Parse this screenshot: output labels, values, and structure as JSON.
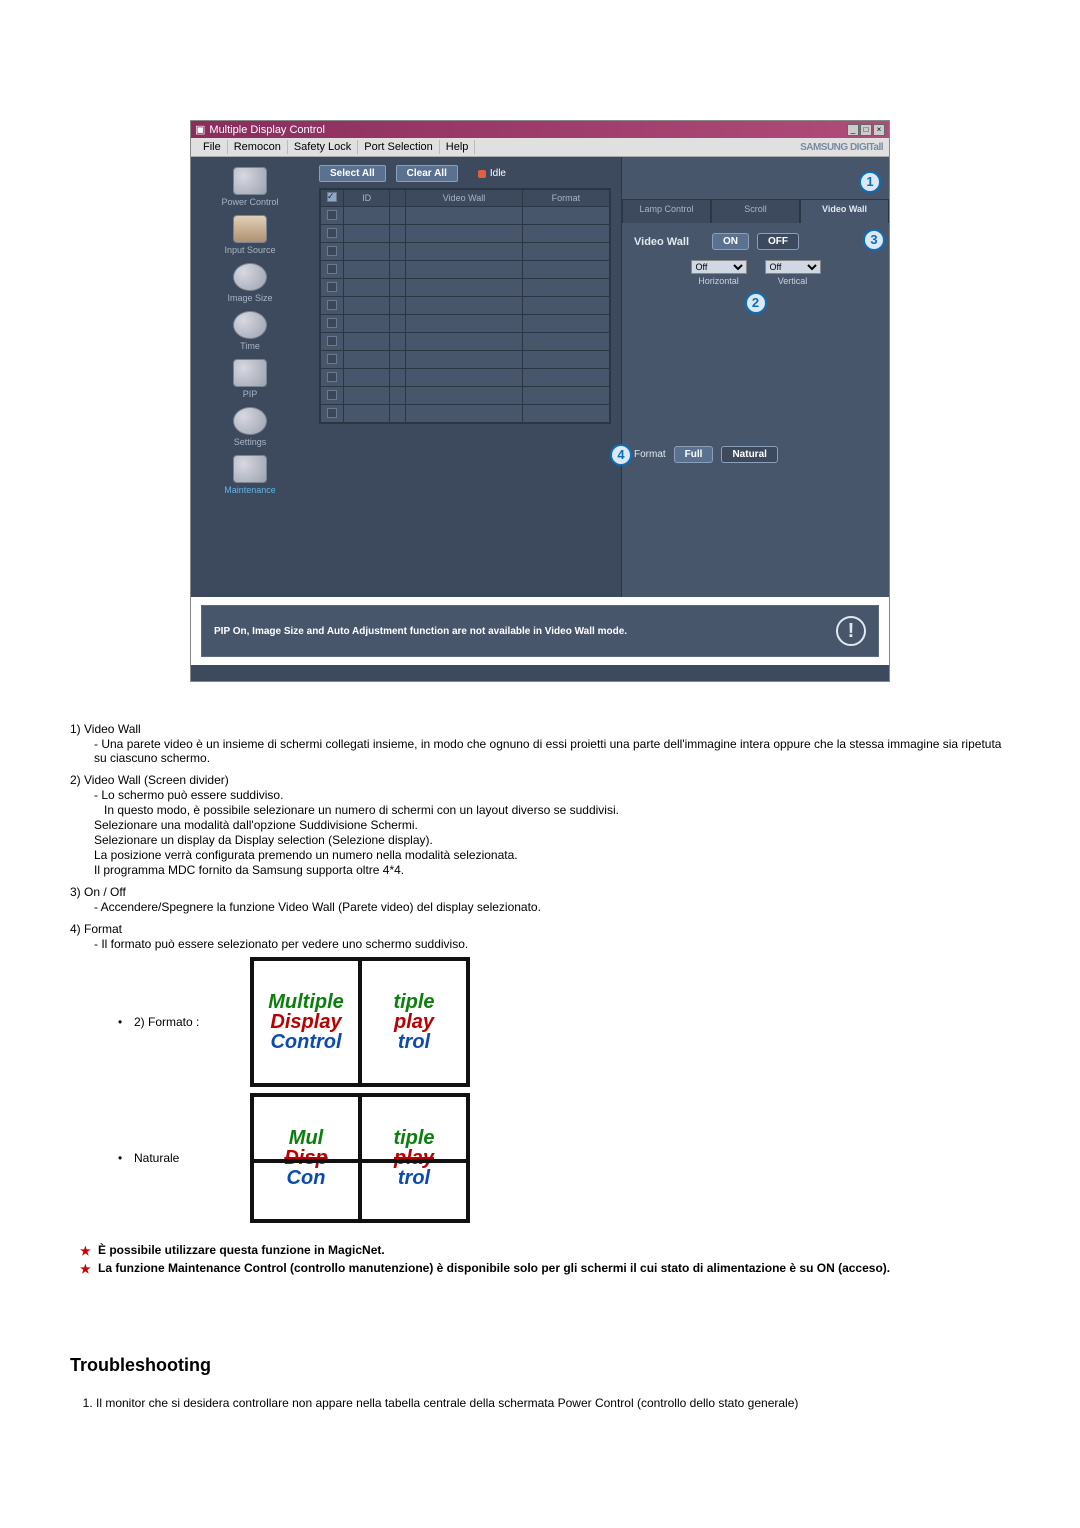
{
  "window": {
    "title": "Multiple Display Control",
    "menus": [
      "File",
      "Remocon",
      "Safety Lock",
      "Port Selection",
      "Help"
    ],
    "brand": "SAMSUNG DIGITall"
  },
  "sidebar": {
    "items": [
      {
        "label": "Power Control"
      },
      {
        "label": "Input Source"
      },
      {
        "label": "Image Size"
      },
      {
        "label": "Time"
      },
      {
        "label": "PIP"
      },
      {
        "label": "Settings"
      },
      {
        "label": "Maintenance"
      }
    ]
  },
  "toolbar": {
    "select_all": "Select All",
    "clear_all": "Clear All",
    "idle": "Idle"
  },
  "table": {
    "headers": [
      "ID",
      "Video Wall",
      "Format"
    ],
    "rows": 12
  },
  "tabs": {
    "lamp": "Lamp Control",
    "scroll": "Scroll",
    "video_wall": "Video Wall"
  },
  "panel": {
    "vw_label": "Video Wall",
    "on": "ON",
    "off": "OFF",
    "h_value": "Off",
    "v_value": "Off",
    "h_label": "Horizontal",
    "v_label": "Vertical",
    "format": "Format",
    "full": "Full",
    "natural": "Natural"
  },
  "warning": "PIP On, Image Size and Auto Adjustment function are not available in Video Wall mode.",
  "callouts": {
    "c1": "1",
    "c2": "2",
    "c3": "3",
    "c4": "4"
  },
  "doc": {
    "i1": {
      "t": "1) Video Wall",
      "a": "Una parete video è un insieme di schermi collegati insieme, in modo che ognuno di essi proietti una parte dell'immagine intera oppure che la stessa immagine sia ripetuta su ciascuno schermo."
    },
    "i2": {
      "t": "2) Video Wall (Screen divider)",
      "a": "Lo schermo può essere suddiviso.",
      "b": "In questo modo, è possibile selezionare un numero di schermi con un layout diverso se suddivisi.",
      "bl": [
        "Selezionare una modalità dall'opzione Suddivisione Schermi.",
        "Selezionare un display da Display selection (Selezione display).",
        "La posizione verrà configurata premendo un numero nella modalità selezionata.",
        "Il programma MDC fornito da Samsung supporta oltre 4*4."
      ]
    },
    "i3": {
      "t": "3) On / Off",
      "a": "Accendere/Spegnere la funzione Video Wall (Parete video) del display selezionato."
    },
    "i4": {
      "t": "4) Format",
      "a": "Il formato può essere selezionato per vedere uno schermo suddiviso.",
      "f1": "2) Formato :",
      "f2": "Naturale"
    },
    "img_words": [
      "Multiple",
      "Display",
      "Control"
    ],
    "stars": [
      "È possibile utilizzare questa funzione in MagicNet.",
      "La funzione Maintenance Control (controllo manutenzione) è disponibile solo per gli schermi il cui stato di alimentazione è su ON (acceso)."
    ],
    "ts_title": "Troubleshooting",
    "ts_items": [
      "Il monitor che si desidera controllare non appare nella tabella centrale della schermata Power Control (controllo dello stato generale)"
    ]
  }
}
